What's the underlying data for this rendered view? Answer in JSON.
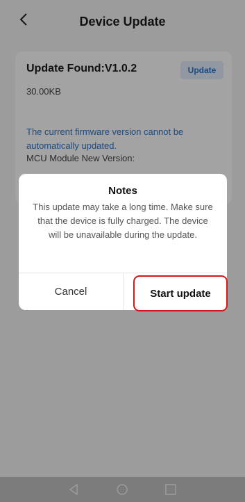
{
  "header": {
    "title": "Device Update",
    "back_icon": "chevron-left-icon"
  },
  "update_card": {
    "found_label": "Update Found:V1.0.2",
    "update_button": "Update",
    "size": "30.00KB",
    "warning_text": "The current firmware version cannot be automatically updated.",
    "mcu_label": "MCU Module New Version:"
  },
  "dialog": {
    "title": "Notes",
    "message": "This update may take a long time. Make sure that the device is fully charged. The device will be unavailable during the update.",
    "cancel_label": "Cancel",
    "start_label": "Start update"
  },
  "navbar": {
    "icons": [
      "back-triangle-icon",
      "home-circle-icon",
      "recents-square-icon"
    ]
  },
  "colors": {
    "accent": "#2a72c8",
    "highlight": "#d91616"
  }
}
